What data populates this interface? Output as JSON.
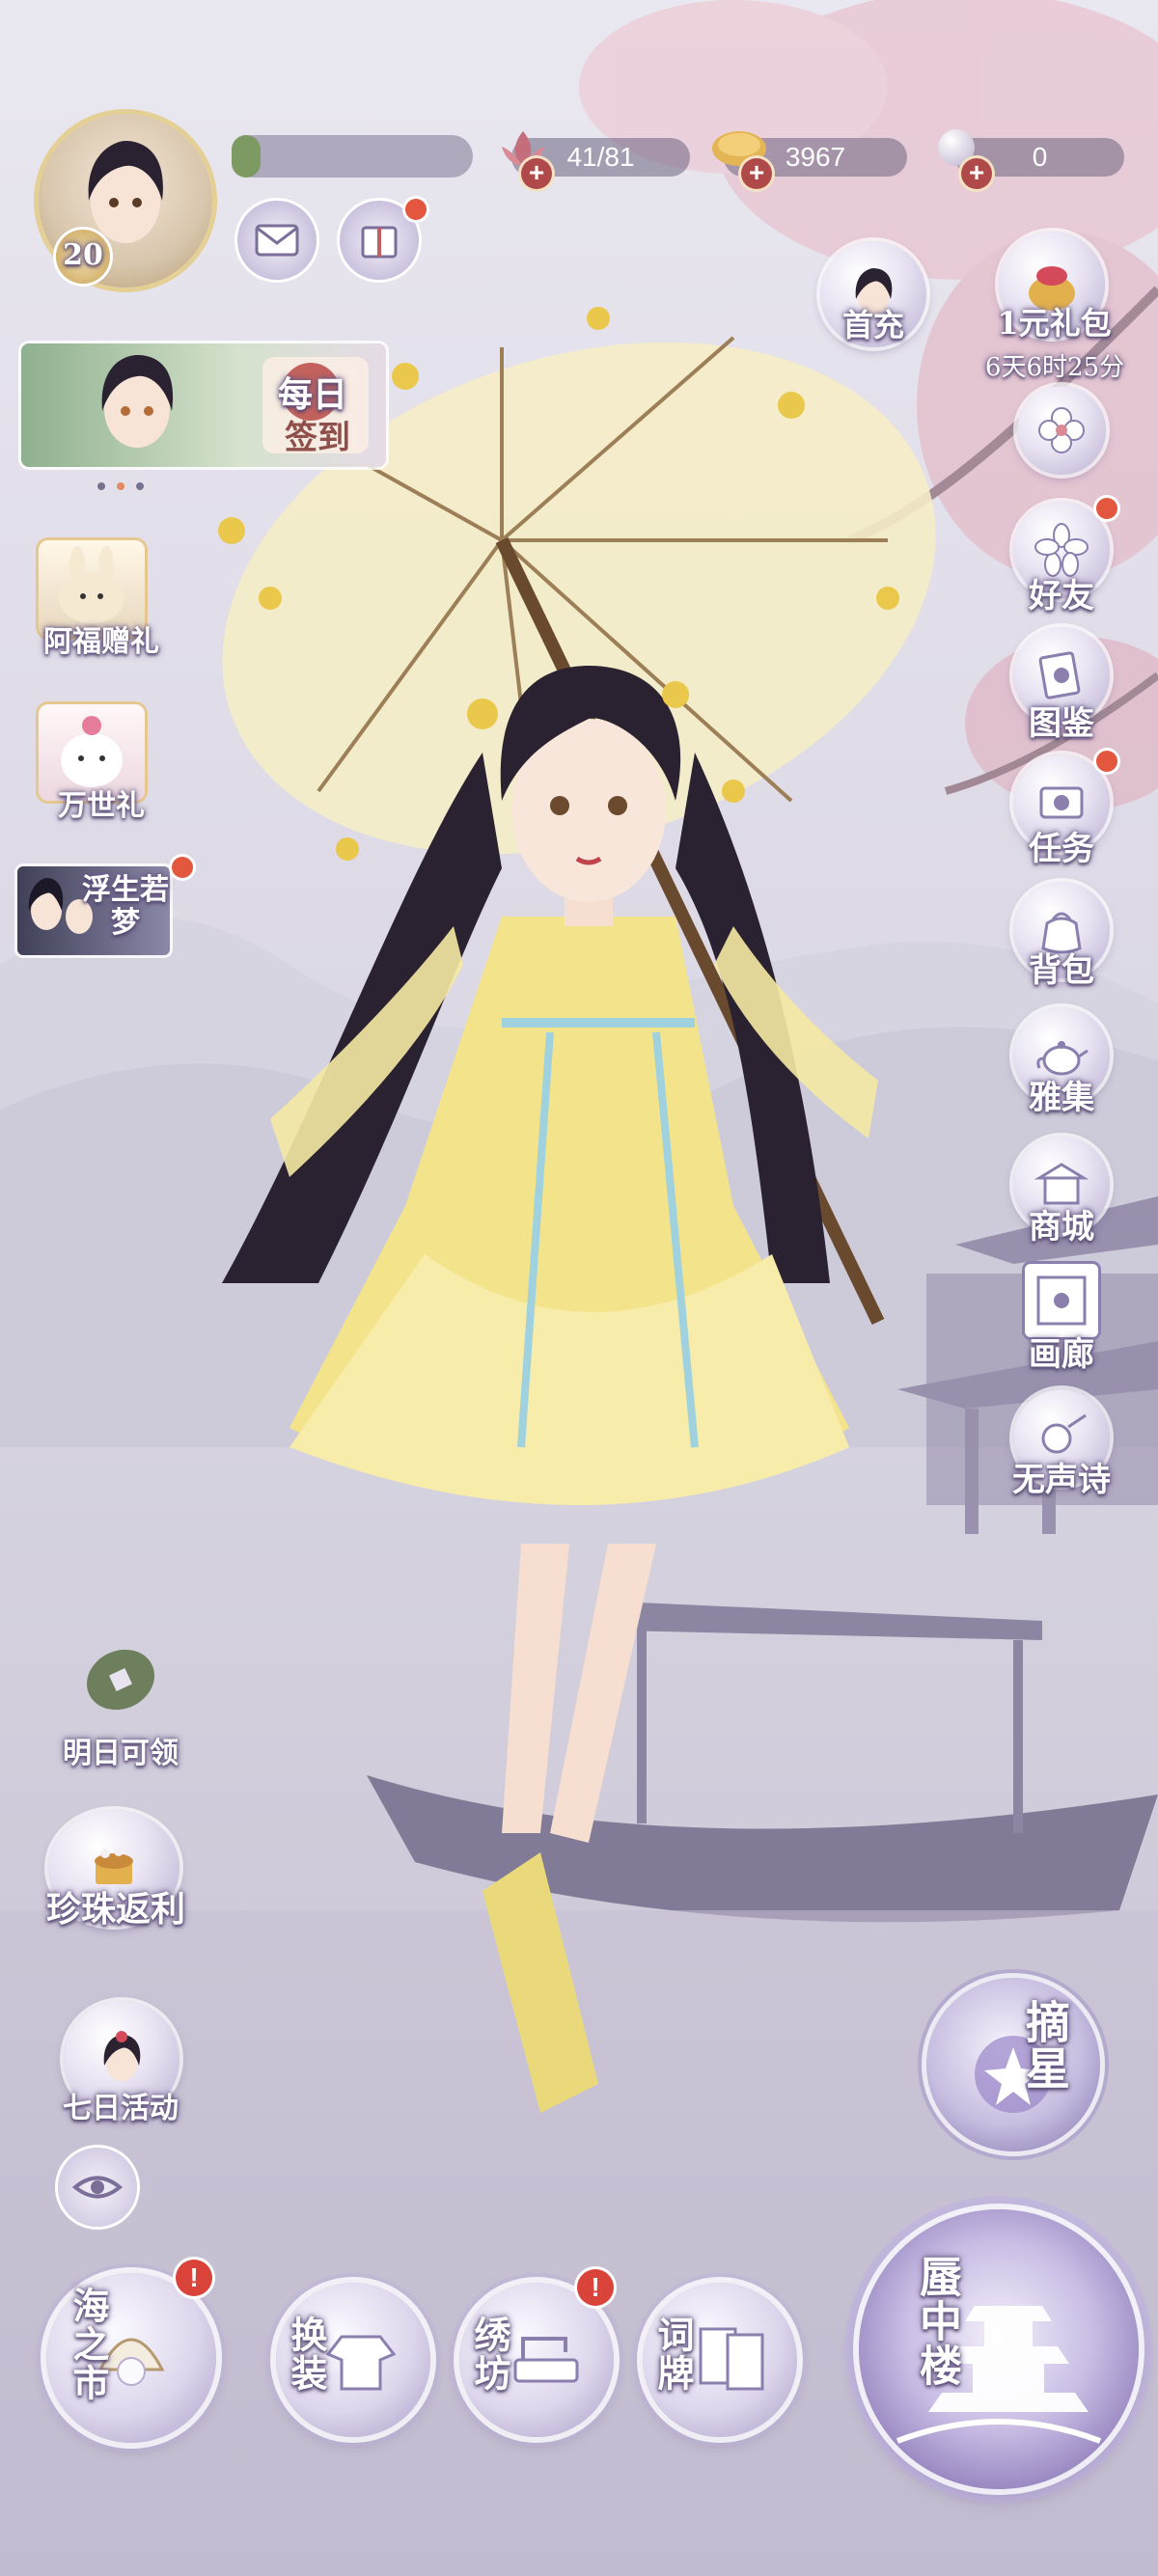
{
  "player": {
    "level": "20"
  },
  "resources": {
    "stamina": "41/81",
    "coins": "3967",
    "pearls": "0"
  },
  "top_right": {
    "first_recharge": "首充",
    "gift_pack": "1元礼包",
    "gift_timer": "6天6时25分"
  },
  "daily_signin": {
    "line1": "每日",
    "line2": "签到"
  },
  "left_events": [
    {
      "label": "阿福赠礼"
    },
    {
      "label": "万世礼"
    },
    {
      "label": "浮生若梦"
    }
  ],
  "right_menu": [
    {
      "label": "好友"
    },
    {
      "label": "图鉴"
    },
    {
      "label": "任务"
    },
    {
      "label": "背包"
    },
    {
      "label": "雅集"
    },
    {
      "label": "商城"
    },
    {
      "label": "画廊"
    },
    {
      "label": "无声诗"
    }
  ],
  "left_lower": [
    {
      "label": "明日可领"
    },
    {
      "label": "珍珠返利"
    },
    {
      "label": "七日活动"
    }
  ],
  "star_pick": "摘星",
  "bottom_nav": [
    {
      "label": "海之市",
      "alert": "!"
    },
    {
      "label": "换装",
      "alert": ""
    },
    {
      "label": "绣坊",
      "alert": "!"
    },
    {
      "label": "词牌",
      "alert": ""
    }
  ],
  "mirage": "蜃中楼",
  "colors": {
    "alert_red": "#e4573f",
    "lavender": "#b8aed0",
    "gold": "#d9b45a"
  }
}
